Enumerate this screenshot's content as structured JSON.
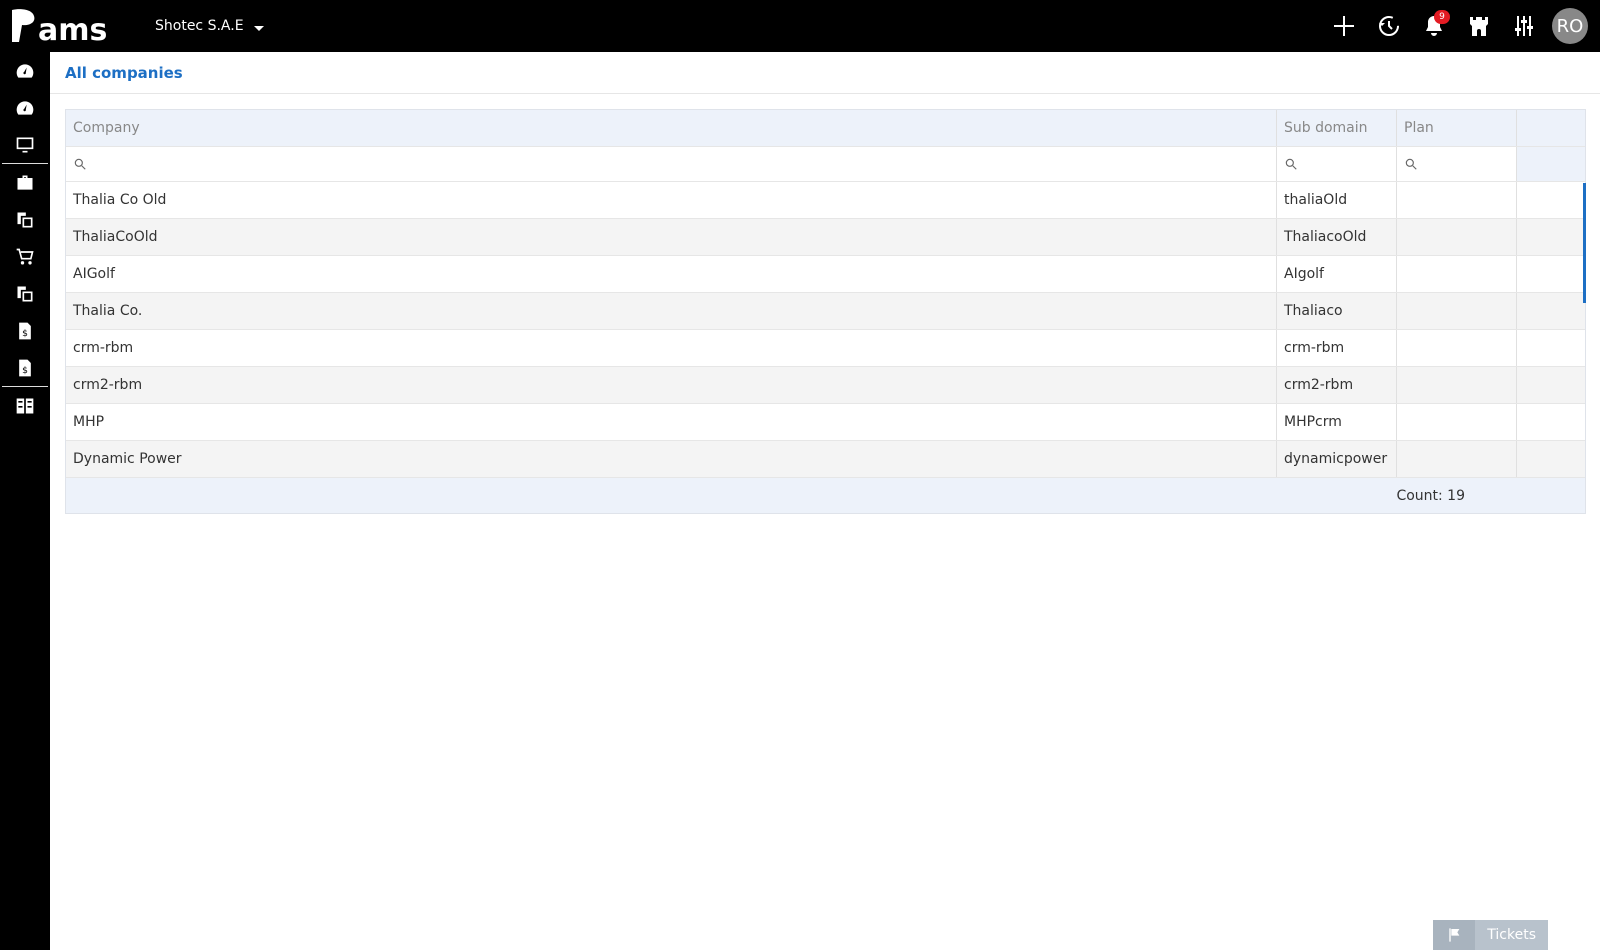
{
  "app": {
    "logo_text": "Pams",
    "company": "Shotec S.A.E"
  },
  "topbar": {
    "notifications_count": "9",
    "avatar_initials": "RO"
  },
  "sidebar": {
    "icons": [
      "dashboard-icon",
      "dashboard-icon",
      "monitor-icon",
      "briefcase-icon",
      "documents-icon",
      "cart-icon",
      "documents-icon",
      "invoice-icon",
      "invoice-icon",
      "grid-icon"
    ]
  },
  "breadcrumb": {
    "title": "All companies"
  },
  "table": {
    "columns": [
      "Company",
      "Sub domain",
      "Plan",
      ""
    ],
    "rows": [
      [
        "Thalia Co Old",
        "thaliaOld",
        "",
        ""
      ],
      [
        "ThaliaCoOld",
        "ThaliacoOld",
        "",
        ""
      ],
      [
        "AIGolf",
        "AIgolf",
        "",
        ""
      ],
      [
        "Thalia Co.",
        "Thaliaco",
        "",
        ""
      ],
      [
        "crm-rbm",
        "crm-rbm",
        "",
        ""
      ],
      [
        "crm2-rbm",
        "crm2-rbm",
        "",
        ""
      ],
      [
        "MHP",
        "MHPcrm",
        "",
        ""
      ],
      [
        "Dynamic Power",
        "dynamicpower",
        "",
        ""
      ]
    ],
    "footer": "Count: 19"
  },
  "tickets": {
    "label": "Tickets"
  }
}
